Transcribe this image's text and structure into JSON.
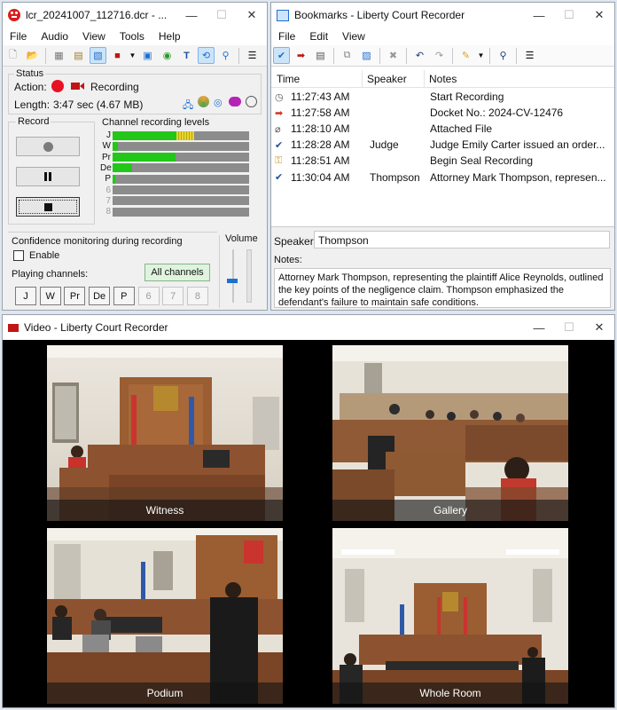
{
  "recorder": {
    "title": "lcr_20241007_112716.dcr - ...",
    "menu": [
      "File",
      "Audio",
      "View",
      "Tools",
      "Help"
    ],
    "status_label": "Status",
    "action_label": "Action:",
    "action_value": "Recording",
    "length_label": "Length:",
    "length_value": "3:47 sec (4.67 MB)",
    "record_label": "Record",
    "levels_label": "Channel recording levels",
    "channels": [
      {
        "name": "J",
        "level": 0.47,
        "peak": 0.13,
        "enabled": true
      },
      {
        "name": "W",
        "level": 0.04,
        "peak": 0,
        "enabled": true
      },
      {
        "name": "Pr",
        "level": 0.46,
        "peak": 0,
        "enabled": true
      },
      {
        "name": "De",
        "level": 0.14,
        "peak": 0,
        "enabled": true
      },
      {
        "name": "P",
        "level": 0.02,
        "peak": 0,
        "enabled": true
      },
      {
        "name": "6",
        "level": 0,
        "peak": 0,
        "enabled": false
      },
      {
        "name": "7",
        "level": 0,
        "peak": 0,
        "enabled": false
      },
      {
        "name": "8",
        "level": 0,
        "peak": 0,
        "enabled": false
      }
    ],
    "confidence_label": "Confidence monitoring during recording",
    "enable_label": "Enable",
    "enable_checked": false,
    "playing_label": "Playing channels:",
    "all_channels_label": "All channels",
    "volume_label": "Volume",
    "volume_level": 0.45
  },
  "bookmarks": {
    "title": "Bookmarks - Liberty Court Recorder",
    "menu": [
      "File",
      "Edit",
      "View"
    ],
    "columns": {
      "time": "Time",
      "speaker": "Speaker",
      "notes": "Notes"
    },
    "rows": [
      {
        "icon": "clock-icon",
        "time": "11:27:43 AM",
        "speaker": "",
        "notes": "Start Recording"
      },
      {
        "icon": "arrow-right-icon",
        "time": "11:27:58 AM",
        "speaker": "",
        "notes": "Docket No.: 2024-CV-12476"
      },
      {
        "icon": "paperclip-icon",
        "time": "11:28:10 AM",
        "speaker": "",
        "notes": "Attached File"
      },
      {
        "icon": "checkmark-icon",
        "time": "11:28:28 AM",
        "speaker": "Judge",
        "notes": "Judge Emily Carter issued an order..."
      },
      {
        "icon": "key-icon",
        "time": "11:28:51 AM",
        "speaker": "",
        "notes": "Begin Seal Recording"
      },
      {
        "icon": "checkmark-icon",
        "time": "11:30:04 AM",
        "speaker": "Thompson",
        "notes": "Attorney Mark Thompson, represen..."
      }
    ],
    "speaker_label": "Speaker:",
    "speaker_value": "Thompson",
    "notes_label": "Notes:",
    "notes_text": "Attorney Mark Thompson, representing the plaintiff Alice Reynolds, outlined the key points of the negligence claim. Thompson emphasized the defendant's failure to maintain safe conditions."
  },
  "video": {
    "title": "Video - Liberty Court Recorder",
    "tiles": [
      {
        "caption": "Witness"
      },
      {
        "caption": "Gallery"
      },
      {
        "caption": "Podium"
      },
      {
        "caption": "Whole Room"
      }
    ]
  },
  "colors": {
    "record_red": "#e81123",
    "level_green": "#22c71a",
    "accent_blue": "#1e6fd0",
    "all_channels_bg": "#dff3df"
  }
}
